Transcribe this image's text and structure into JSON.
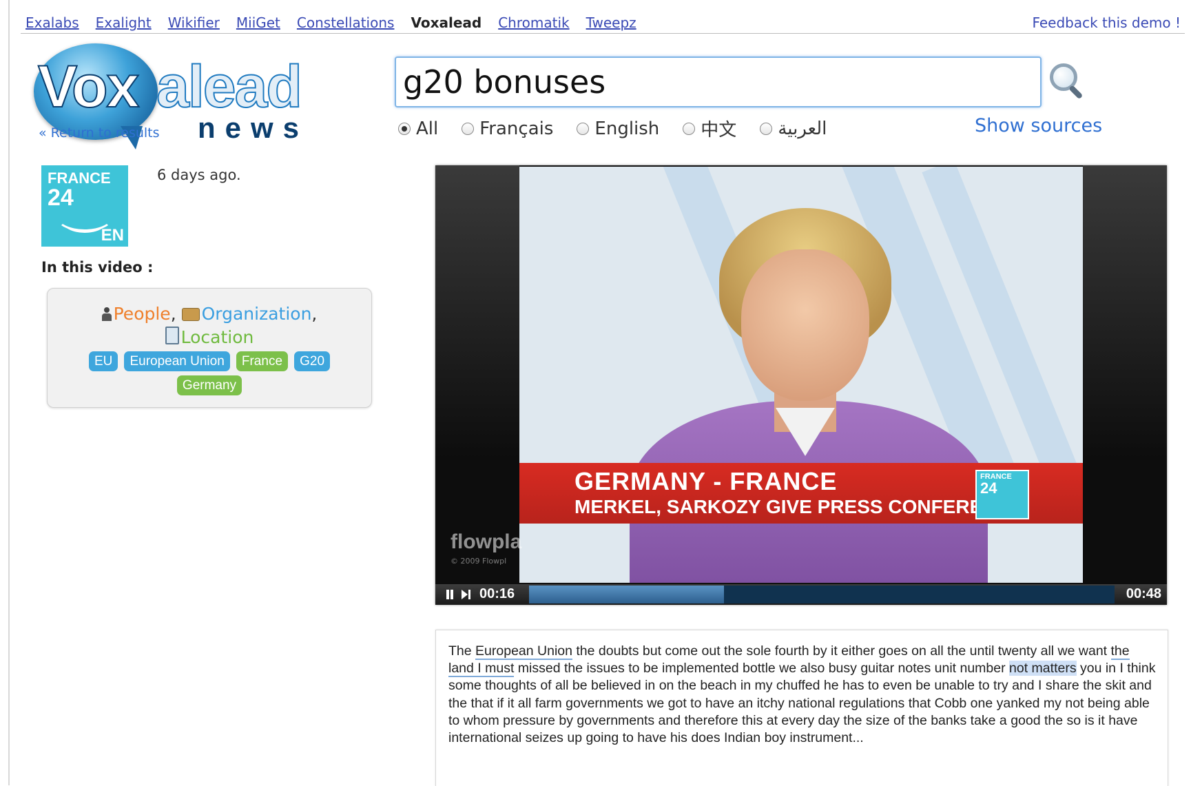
{
  "nav": {
    "links": [
      "Exalabs",
      "Exalight",
      "Wikifier",
      "MiiGet",
      "Constellations",
      "Voxalead",
      "Chromatik",
      "Tweepz"
    ],
    "current": "Voxalead",
    "feedback": "Feedback this demo !"
  },
  "logo": {
    "word_vox": "Vox",
    "word_alead": "alead",
    "word_news": "news"
  },
  "return_link": "« Return to results",
  "source": {
    "logo_line1": "FRANCE",
    "logo_line2": "24",
    "logo_line3": "EN",
    "date": "6 days ago."
  },
  "in_video": {
    "title": "In this video :",
    "types": {
      "people": "People",
      "organization": "Organization",
      "location": "Location"
    },
    "tags": [
      {
        "label": "EU",
        "kind": "organization"
      },
      {
        "label": "European Union",
        "kind": "organization"
      },
      {
        "label": "France",
        "kind": "location"
      },
      {
        "label": "G20",
        "kind": "organization"
      },
      {
        "label": "Germany",
        "kind": "location"
      }
    ]
  },
  "search": {
    "query": "g20 bonuses",
    "languages": [
      "All",
      "Français",
      "English",
      "中文",
      "العربية"
    ],
    "selected_language": "All",
    "show_sources": "Show sources"
  },
  "video": {
    "headline": "GERMANY - FRANCE",
    "subheadline": "MERKEL, SARKOZY GIVE PRESS CONFERENCE",
    "badge_small": "FRANCE",
    "badge_big": "24",
    "watermark": "flowpla",
    "watermark_copy": "© 2009 Flowpl",
    "time_current": "00:16",
    "time_total": "00:48",
    "progress_fraction": 0.333
  },
  "transcript": {
    "before_entity": "The ",
    "entity": "European Union",
    "part2": " the doubts but come out the sole fourth by it either goes on all the until twenty all we want ",
    "phrase": "the land I must",
    "part3": " missed the issues to be implemented bottle we also busy guitar notes unit number ",
    "match": "not matters",
    "rest": " you in I think some thoughts of all be believed in on the beach in my chuffed he has to even be unable to try and I share the skit and the that if it all farm governments we got to have an itchy national regulations that Cobb one yanked my not being able to whom pressure by governments and therefore this at every day the size of the banks take a good the so is it have international seizes up going to have his does Indian boy instrument..."
  }
}
